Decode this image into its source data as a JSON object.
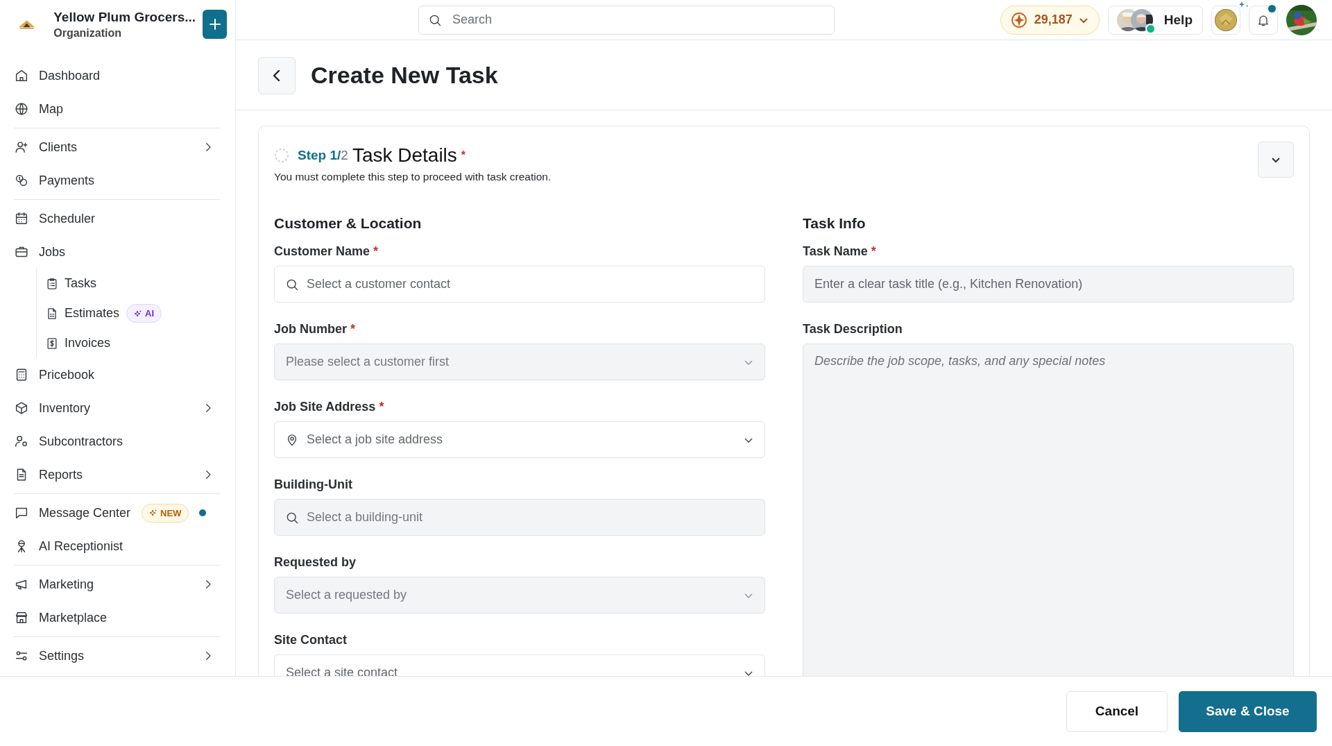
{
  "sidebar": {
    "org": {
      "name": "Yellow Plum Grocers...",
      "subtitle": "Organization"
    },
    "groups": [
      {
        "items": [
          {
            "label": "Dashboard",
            "kind": "home",
            "expandable": false
          },
          {
            "label": "Map",
            "kind": "globe",
            "expandable": false
          }
        ]
      },
      {
        "items": [
          {
            "label": "Clients",
            "kind": "user-plus",
            "expandable": true
          },
          {
            "label": "Payments",
            "kind": "coins",
            "expandable": false
          }
        ]
      },
      {
        "items": [
          {
            "label": "Scheduler",
            "kind": "calendar",
            "expandable": false
          },
          {
            "label": "Jobs",
            "kind": "briefcase",
            "expandable": false,
            "children": [
              {
                "label": "Tasks",
                "kind": "clipboard"
              },
              {
                "label": "Estimates",
                "kind": "document",
                "badge": {
                  "text": "AI",
                  "kind": "ai"
                }
              },
              {
                "label": "Invoices",
                "kind": "dollar"
              }
            ]
          },
          {
            "label": "Pricebook",
            "kind": "calculator",
            "expandable": false
          },
          {
            "label": "Inventory",
            "kind": "box",
            "expandable": true
          },
          {
            "label": "Subcontractors",
            "kind": "user-gear",
            "expandable": false
          },
          {
            "label": "Reports",
            "kind": "report",
            "expandable": true
          }
        ]
      },
      {
        "items": [
          {
            "label": "Message Center",
            "kind": "message",
            "expandable": false,
            "badge": {
              "text": "NEW",
              "kind": "new"
            },
            "unread": true
          },
          {
            "label": "AI Receptionist",
            "kind": "receptionist",
            "expandable": false
          }
        ]
      },
      {
        "items": [
          {
            "label": "Marketing",
            "kind": "megaphone",
            "expandable": true
          },
          {
            "label": "Marketplace",
            "kind": "store",
            "expandable": false
          }
        ]
      },
      {
        "items": [
          {
            "label": "Settings",
            "kind": "sliders",
            "expandable": true
          }
        ]
      }
    ]
  },
  "topbar": {
    "search": {
      "placeholder": "Search"
    },
    "coins": "29,187",
    "help": "Help",
    "notifications_unread": true
  },
  "page": {
    "title": "Create New Task"
  },
  "step": {
    "current": "Step 1/",
    "total": "2",
    "title": "Task Details",
    "required_mark": "*",
    "note": "You must complete this step to proceed with task creation.",
    "expanded": true
  },
  "columns": [
    {
      "title": "Customer & Location",
      "fields": [
        {
          "label": "Customer Name",
          "required_mark": "*",
          "kind": "search",
          "placeholder": "Select a customer contact",
          "disabled": false
        },
        {
          "label": "Job Number",
          "required_mark": "*",
          "kind": "select",
          "placeholder": "Please select a customer first",
          "disabled": true
        },
        {
          "label": "Job Site Address",
          "required_mark": "*",
          "kind": "location",
          "placeholder": "Select a job site address",
          "disabled": false
        },
        {
          "label": "Building-Unit",
          "kind": "search",
          "placeholder": "Select a building-unit",
          "disabled": true
        },
        {
          "label": "Requested by",
          "kind": "select",
          "placeholder": "Select a requested by",
          "disabled": true
        },
        {
          "label": "Site Contact",
          "kind": "select",
          "placeholder": "Select a site contact",
          "disabled": false
        }
      ]
    },
    {
      "title": "Task Info",
      "fields": [
        {
          "label": "Task Name",
          "required_mark": "*",
          "kind": "text",
          "placeholder": "Enter a clear task title (e.g., Kitchen Renovation)",
          "disabled": false
        },
        {
          "label": "Task Description",
          "kind": "textarea",
          "placeholder": "Describe the job scope, tasks, and any special notes",
          "disabled": false
        }
      ]
    }
  ],
  "footer": {
    "buttons": [
      {
        "label": "Cancel",
        "kind": "secondary"
      },
      {
        "label": "Save & Close",
        "kind": "primary"
      }
    ]
  }
}
